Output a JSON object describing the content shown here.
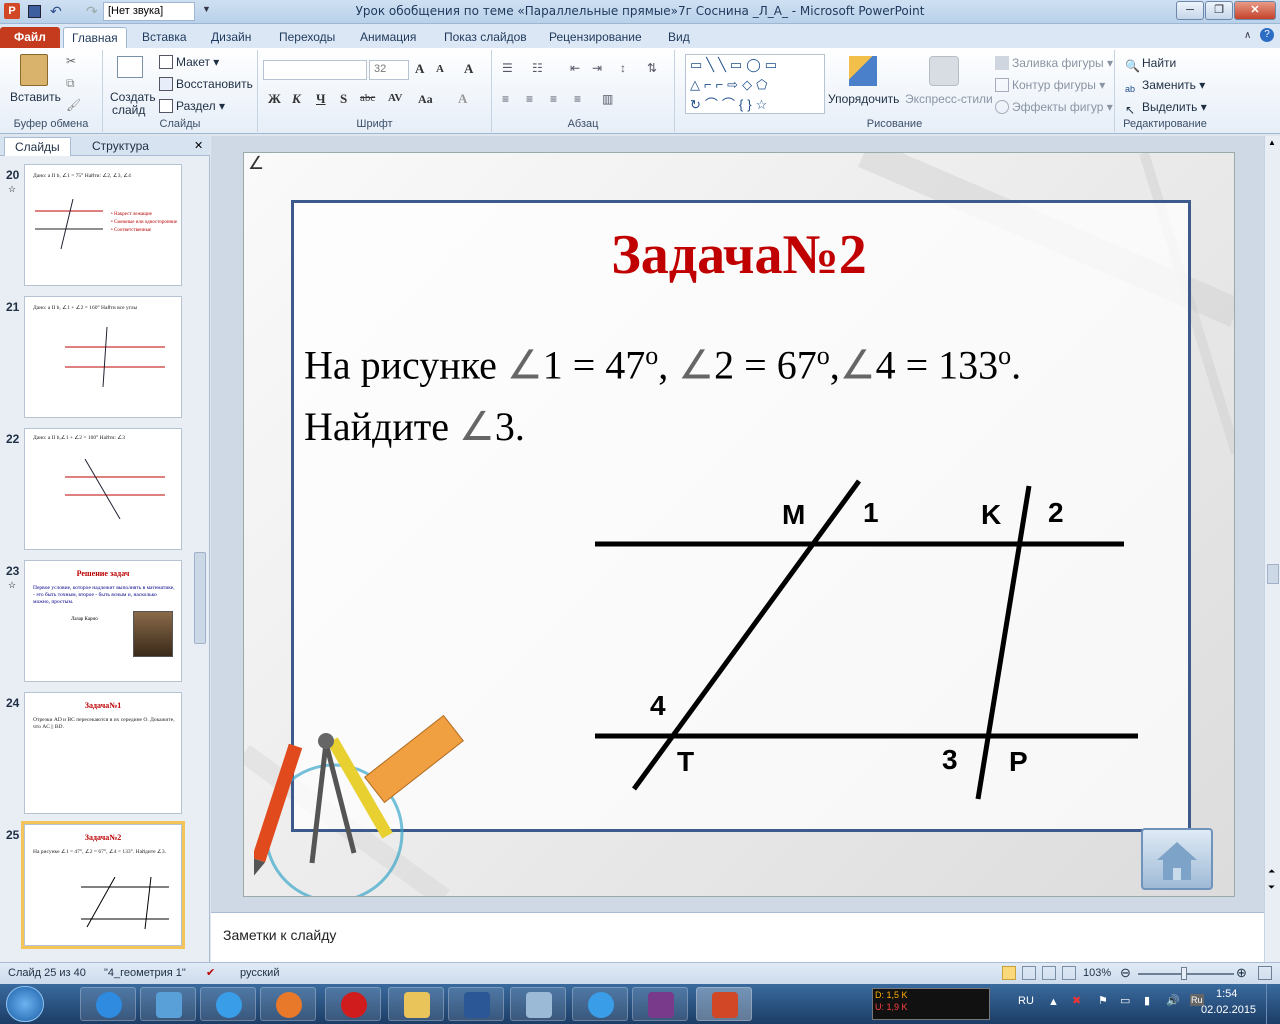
{
  "titlebar": {
    "title": "Урок обобщения по теме «Параллельные прямые»7г Соснина _Л_А_ - Microsoft PowerPoint",
    "sound_combo": "[Нет звука]"
  },
  "tabs": [
    "Файл",
    "Главная",
    "Вставка",
    "Дизайн",
    "Переходы",
    "Анимация",
    "Показ слайдов",
    "Рецензирование",
    "Вид"
  ],
  "ribbon": {
    "clipboard": {
      "paste": "Вставить",
      "label": "Буфер обмена"
    },
    "slides": {
      "new_slide_1": "Создать",
      "new_slide_2": "слайд",
      "layout": "Макет",
      "reset": "Восстановить",
      "section": "Раздел",
      "label": "Слайды"
    },
    "font": {
      "font_name": "",
      "font_size": "32",
      "bold": "Ж",
      "italic": "К",
      "underline": "Ч",
      "shadow": "S",
      "strike": "abc",
      "spacing": "AV",
      "case": "Aa",
      "grow": "A",
      "shrink": "A",
      "clear": "A",
      "label": "Шрифт"
    },
    "paragraph": {
      "label": "Абзац"
    },
    "drawing": {
      "arrange": "Упорядочить",
      "quick_styles": "Экспресс-стили",
      "fill": "Заливка фигуры",
      "outline": "Контур фигуры",
      "effects": "Эффекты фигур",
      "label": "Рисование"
    },
    "editing": {
      "find": "Найти",
      "replace": "Заменить",
      "select": "Выделить",
      "label": "Редактирование"
    }
  },
  "panel": {
    "tab_slides": "Слайды",
    "tab_outline": "Структура"
  },
  "thumbnails": [
    {
      "num": "20",
      "title": "",
      "text": "Дано: a II b, ∠1 = 75° Найти: ∠2, ∠3, ∠4",
      "bullets": [
        "Накрест лежащие",
        "Смежные или односторонние",
        "Соответственные"
      ]
    },
    {
      "num": "21",
      "title": "",
      "text": "Дано: a II b, ∠1 + ∠2 = 160° Найти все углы",
      "bullets": []
    },
    {
      "num": "22",
      "title": "",
      "text": "Дано: a II b,∠1 + ∠2 = 100° Найти: ∠3",
      "bullets": []
    },
    {
      "num": "23",
      "title": "Решение задач",
      "text": "Первое условие, которое надлежит выполнять в математике, - это быть точным, второе - быть ясным и, насколько можно, простым.",
      "author": "Лазар Карно",
      "bullets": []
    },
    {
      "num": "24",
      "title": "Задача№1",
      "text": "Отрезки AD и BC пересекаются в их середине O. Докажите, что AC || BD.",
      "bullets": []
    },
    {
      "num": "25",
      "title": "Задача№2",
      "text": "На рисунке ∠1 = 47°, ∠2 = 67°, ∠4 = 133°. Найдите ∠3.",
      "bullets": []
    }
  ],
  "slide": {
    "title": "Задача№2",
    "line1_a": "На рисунке ",
    "angle": "∠",
    "line1_b": "1 = 47",
    "deg": "o",
    "line1_c": ", ",
    "line1_d": "2 = 67",
    "line1_e": ",",
    "line1_f": "4 = 133",
    "line1_g": ".",
    "line2_a": "Найдите ",
    "line2_b": "3.",
    "labels": {
      "M": "M",
      "one": "1",
      "K": "K",
      "two": "2",
      "four": "4",
      "T": "T",
      "three": "3",
      "P": "P"
    }
  },
  "notes": {
    "placeholder": "Заметки к слайду"
  },
  "status": {
    "slide": "Слайд 25 из 40",
    "theme": "\"4_геометрия 1\"",
    "lang": "русский",
    "zoom": "103%"
  },
  "tray": {
    "lang": "RU",
    "time": "1:54",
    "date": "02.02.2015",
    "net_down": "D: 1,5 K",
    "net_up": "U: 1,9 K"
  }
}
